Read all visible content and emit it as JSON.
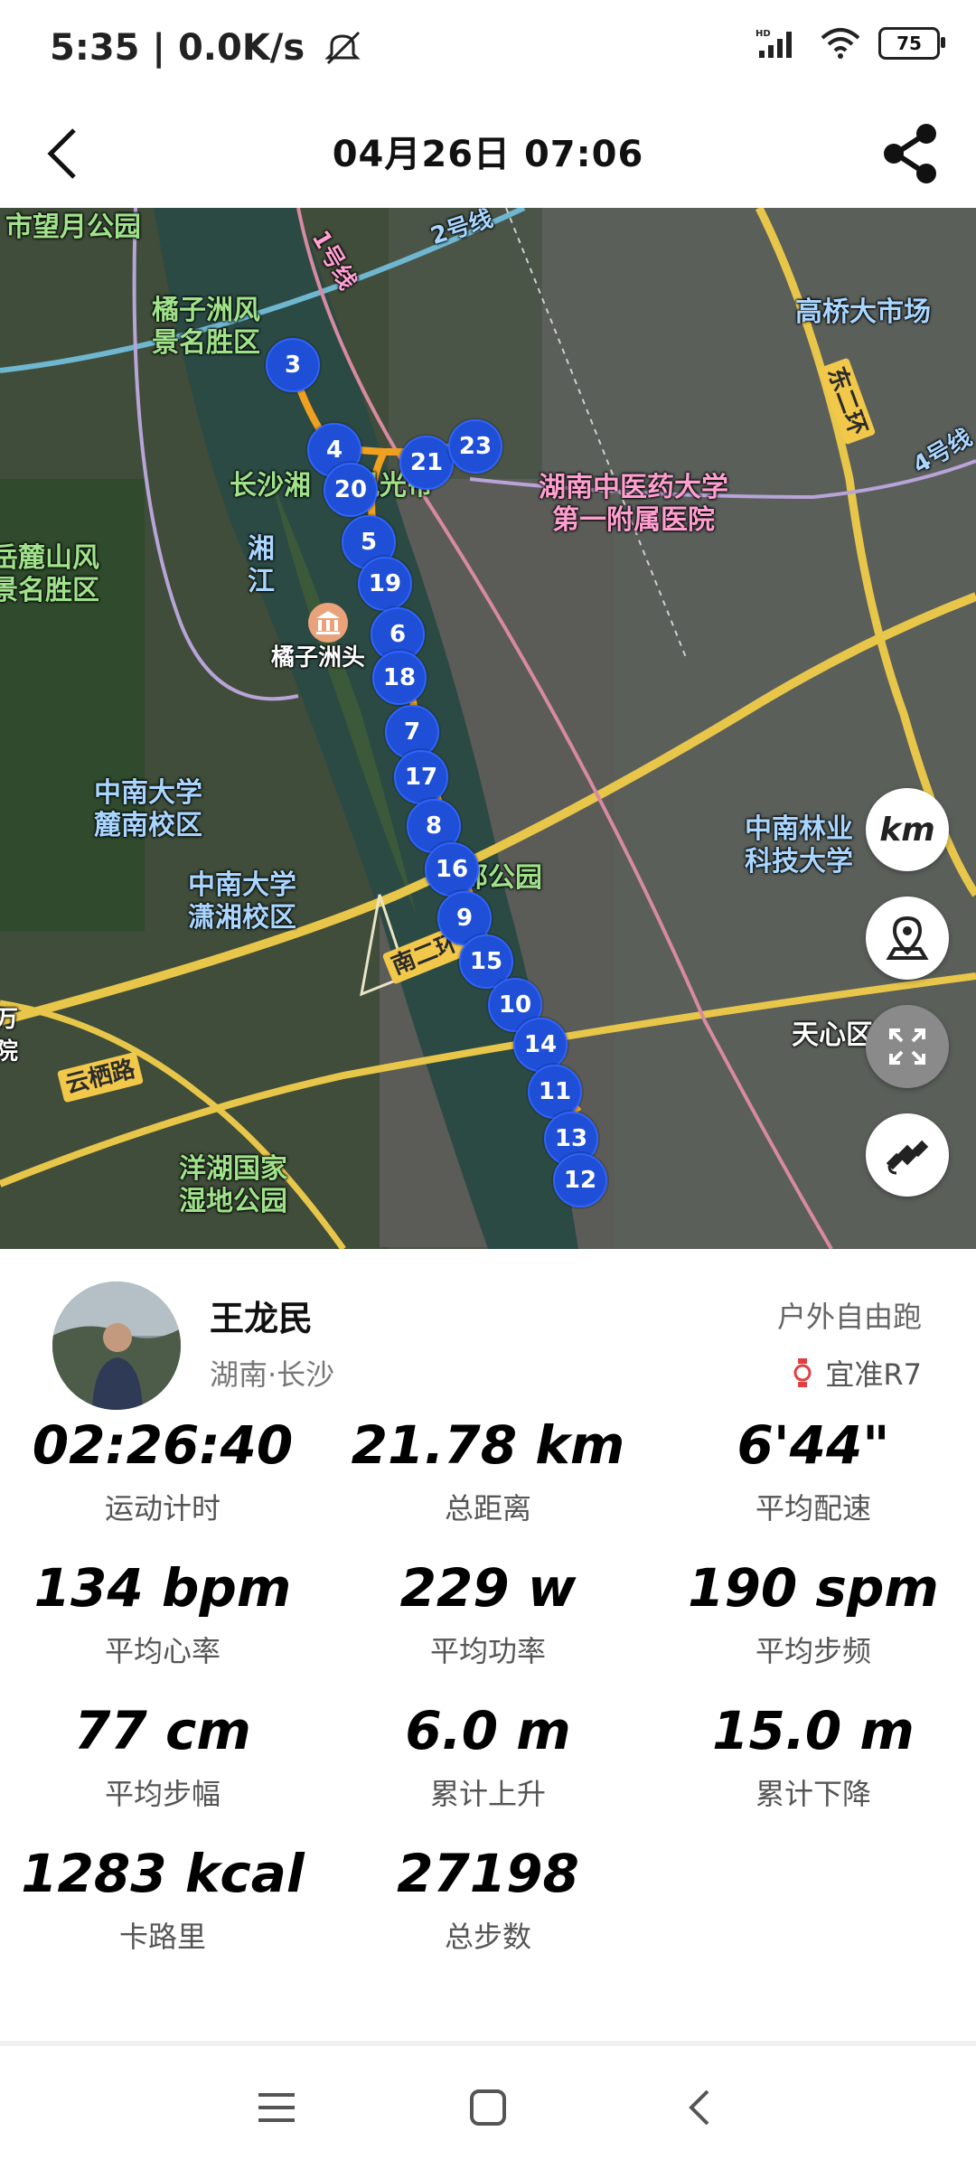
{
  "status_bar": {
    "time": "5:35 | 0.0K/s",
    "battery": "75"
  },
  "header": {
    "title": "04月26日 07:06"
  },
  "map": {
    "labels": [
      "市望月公园",
      "橘子洲风\n景名胜区",
      "长沙湘",
      "风光带",
      "湘\n江",
      "橘子洲头",
      "湖南中医药大学\n第一附属医院",
      "高桥大市场",
      "东二环",
      "4号线",
      "2号线",
      "1号线",
      "岳麓山风\n景名胜区",
      "中南大学\n麓南校区",
      "中南大学\n潇湘校区",
      "中南林业\n科技大学",
      "郊公园",
      "南二环",
      "云栖路",
      "洋湖国家\n湿地公园",
      "天心区",
      "万\n院"
    ],
    "markers": [
      "3",
      "4",
      "20",
      "21",
      "23",
      "5",
      "19",
      "6",
      "18",
      "7",
      "17",
      "8",
      "16",
      "9",
      "15",
      "10",
      "14",
      "11",
      "13",
      "12"
    ],
    "buttons": {
      "unit": "km"
    }
  },
  "user": {
    "name": "王龙民",
    "location": "湖南·长沙",
    "sport_type": "户外自由跑",
    "device": "宜准R7"
  },
  "stats": [
    {
      "value": "02:26:40",
      "label": "运动计时"
    },
    {
      "value": "21.78 km",
      "label": "总距离"
    },
    {
      "value": "6'44\"",
      "label": "平均配速"
    },
    {
      "value": "134 bpm",
      "label": "平均心率"
    },
    {
      "value": "229 w",
      "label": "平均功率"
    },
    {
      "value": "190 spm",
      "label": "平均步频"
    },
    {
      "value": "77 cm",
      "label": "平均步幅"
    },
    {
      "value": "6.0 m",
      "label": "累计上升"
    },
    {
      "value": "15.0 m",
      "label": "累计下降"
    },
    {
      "value": "1283 kcal",
      "label": "卡路里"
    },
    {
      "value": "27198",
      "label": "总步数"
    }
  ]
}
